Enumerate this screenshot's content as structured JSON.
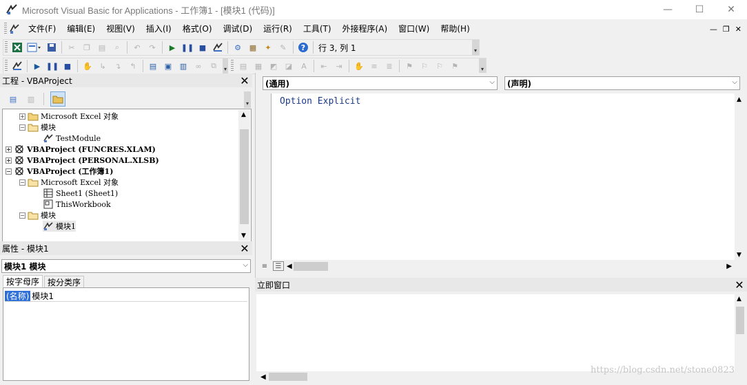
{
  "window": {
    "title": "Microsoft Visual Basic for Applications - 工作簿1 - [模块1 (代码)]",
    "minimize": "—",
    "maximize": "☐",
    "close": "✕"
  },
  "menu": {
    "items": [
      "文件(F)",
      "编辑(E)",
      "视图(V)",
      "插入(I)",
      "格式(O)",
      "调试(D)",
      "运行(R)",
      "工具(T)",
      "外接程序(A)",
      "窗口(W)",
      "帮助(H)"
    ],
    "mdi_minimize": "—",
    "mdi_restore": "❐",
    "mdi_close": "✕"
  },
  "toolbar": {
    "position": "行 3, 列 1"
  },
  "project_pane": {
    "title": "工程 - VBAProject",
    "tree": [
      {
        "label": "Microsoft Excel 对象",
        "expander": "+"
      },
      {
        "label": "模块",
        "expander": "−"
      },
      {
        "label": "TestModule"
      },
      {
        "label": "VBAProject (FUNCRES.XLAM)",
        "expander": "+"
      },
      {
        "label": "VBAProject (PERSONAL.XLSB)",
        "expander": "+"
      },
      {
        "label": "VBAProject (工作簿1)",
        "expander": "−"
      },
      {
        "label": "Microsoft Excel 对象",
        "expander": "−"
      },
      {
        "label": "Sheet1 (Sheet1)"
      },
      {
        "label": "ThisWorkbook"
      },
      {
        "label": "模块",
        "expander": "−"
      },
      {
        "label": "模块1"
      }
    ]
  },
  "properties_pane": {
    "title": "属性 - 模块1",
    "object_select": "模块1 模块",
    "tabs": [
      "按字母序",
      "按分类序"
    ],
    "property_name": "(名称)",
    "property_value": "模块1"
  },
  "code_window": {
    "object_select": "(通用)",
    "procedure_select": "(声明)",
    "code": "Option Explicit"
  },
  "immediate_pane": {
    "title": "立即窗口"
  },
  "watermark": "https://blog.csdn.net/stone0823"
}
